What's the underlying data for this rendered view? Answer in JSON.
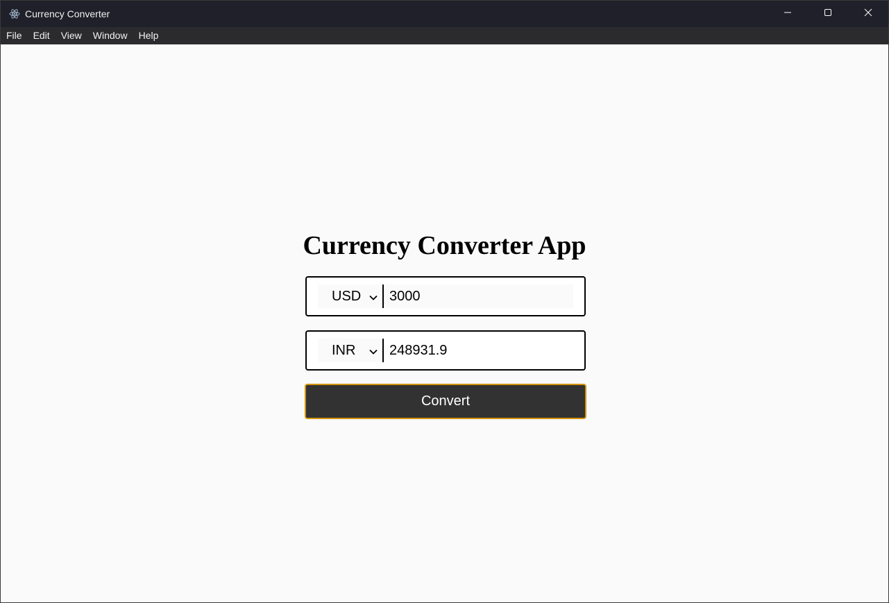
{
  "window": {
    "title": "Currency Converter",
    "app_icon": "electron-icon",
    "controls": [
      "minimize-icon",
      "maximize-icon",
      "close-icon"
    ]
  },
  "menu": {
    "items": [
      "File",
      "Edit",
      "View",
      "Window",
      "Help"
    ]
  },
  "main": {
    "title": "Currency Converter App",
    "from": {
      "currency": "USD",
      "amount": "3000"
    },
    "to": {
      "currency": "INR",
      "amount": "248931.9"
    },
    "convert_label": "Convert"
  },
  "colors": {
    "titlebar_bg": "#1f2029",
    "menubar_bg": "#2b2b2e",
    "content_bg": "#fafafa",
    "button_bg": "#323232",
    "button_border": "#d4920b"
  }
}
